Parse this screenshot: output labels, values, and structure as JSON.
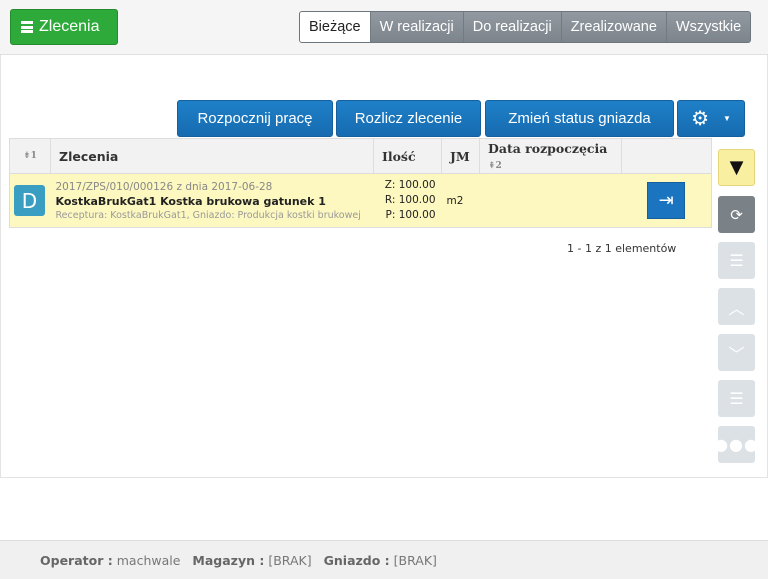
{
  "header": {
    "brand": "Zlecenia",
    "tabs": [
      {
        "label": "Bieżące",
        "active": true
      },
      {
        "label": "W realizacji"
      },
      {
        "label": "Do realizacji"
      },
      {
        "label": "Zrealizowane"
      },
      {
        "label": "Wszystkie"
      }
    ]
  },
  "toolbar": {
    "start": "Rozpocznij pracę",
    "settle": "Rozlicz zlecenie",
    "status": "Zmień status gniazda"
  },
  "table": {
    "columns": [
      "Zlecenia",
      "Ilość",
      "JM",
      "Data rozpoczęcia"
    ],
    "sort1": "1",
    "sort2": "2",
    "rows": [
      {
        "badge": "D",
        "number": "2017/ZPS/010/000126 z dnia 2017-06-28",
        "name": "KostkaBrukGat1 Kostka brukowa gatunek 1",
        "details": "Receptura: KostkaBrukGat1, Gniazdo: Produkcja kostki brukowej",
        "z": "Z: 100.00",
        "r": "R: 100.00",
        "p": "P: 100.00",
        "jm": "m2",
        "date": ""
      }
    ]
  },
  "pagination": "1 - 1 z 1 elementów",
  "footer": {
    "operator_label": "Operator :",
    "operator": "machwale",
    "magazyn_label": "Magazyn :",
    "magazyn": "[BRAK]",
    "gniazdo_label": "Gniazdo :",
    "gniazdo": "[BRAK]"
  },
  "colors": {
    "brand": "#2eaa3a",
    "primary": "#1a74bf",
    "row_highlight": "#fdf8c0",
    "filter": "#f8efa0"
  }
}
